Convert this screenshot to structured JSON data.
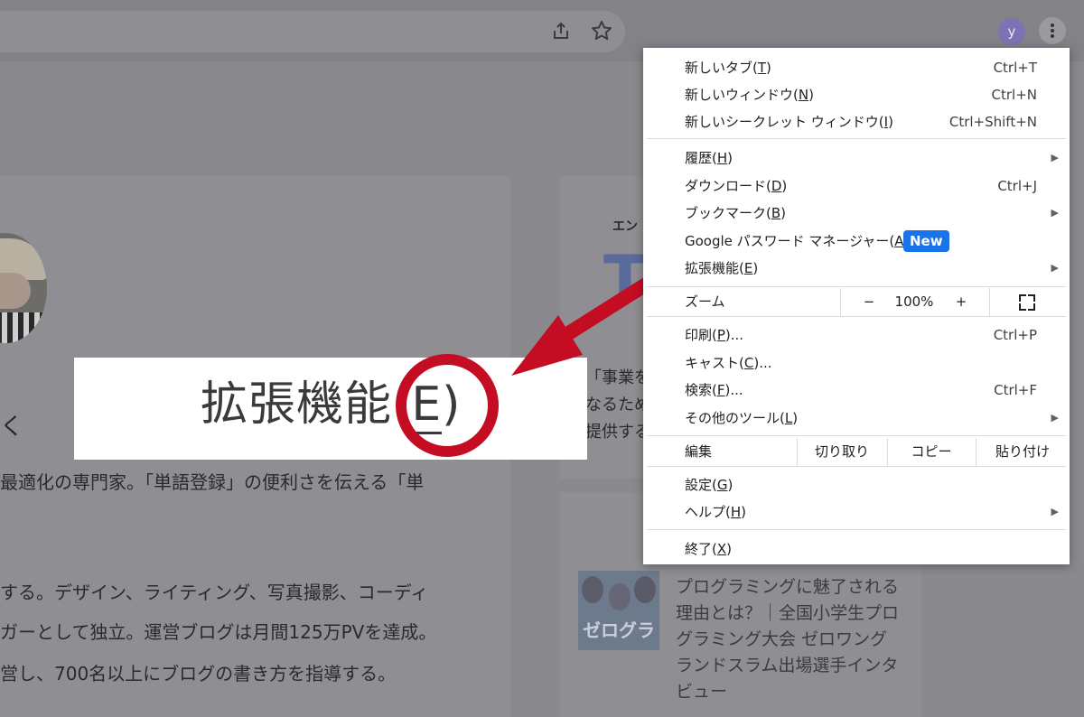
{
  "browser": {
    "avatar_letter": "y",
    "share_icon": "share-icon",
    "star_icon": "star-icon"
  },
  "background_page": {
    "left_card": {
      "line1": "最適化の専門家。「単語登録」の便利さを伝える「単",
      "line2": "する。デザイン、ライティング、写真撮影、コーディ",
      "line3": "ガーとして独立。運営ブログは月間125万PVを達成。",
      "line4": "営し、700名以上にブログの書き方を指導する。",
      "fragment": "く"
    },
    "right_card": {
      "small_label": "エン",
      "line1": "「事業を",
      "line2": "なるため",
      "line3": "提供する",
      "big_letter": "T"
    },
    "article": {
      "thumb_label": "ゼログラ",
      "title": "プログラミングに魅了される理由とは？｜全国小学生プログラミング大会 ゼロワングランドスラム出場選手インタビュー"
    }
  },
  "callout": {
    "text": "拡張機能",
    "paren_open": "(",
    "key": "E",
    "paren_close": ")"
  },
  "menu": {
    "new_tab": {
      "label": "新しいタブ(",
      "key": "T",
      "close": ")",
      "shortcut": "Ctrl+T"
    },
    "new_window": {
      "label": "新しいウィンドウ(",
      "key": "N",
      "close": ")",
      "shortcut": "Ctrl+N"
    },
    "incognito": {
      "label": "新しいシークレット ウィンドウ(",
      "key": "I",
      "close": ")",
      "shortcut": "Ctrl+Shift+N"
    },
    "history": {
      "label": "履歴(",
      "key": "H",
      "close": ")"
    },
    "downloads": {
      "label": "ダウンロード(",
      "key": "D",
      "close": ")",
      "shortcut": "Ctrl+J"
    },
    "bookmarks": {
      "label": "ブックマーク(",
      "key": "B",
      "close": ")"
    },
    "password_manager": {
      "label": "Google パスワード マネージャー(",
      "key": "A",
      "close": ")",
      "badge": "New"
    },
    "extensions": {
      "label": "拡張機能(",
      "key": "E",
      "close": ")"
    },
    "zoom": {
      "label": "ズーム",
      "minus": "−",
      "value": "100%",
      "plus": "+"
    },
    "print": {
      "label": "印刷(",
      "key": "P",
      "close": ")...",
      "shortcut": "Ctrl+P"
    },
    "cast": {
      "label": "キャスト(",
      "key": "C",
      "close": ")..."
    },
    "find": {
      "label": "検索(",
      "key": "F",
      "close": ")...",
      "shortcut": "Ctrl+F"
    },
    "more_tools": {
      "label": "その他のツール(",
      "key": "L",
      "close": ")"
    },
    "edit": {
      "label": "編集",
      "cut": "切り取り",
      "copy": "コピー",
      "paste": "貼り付け"
    },
    "settings": {
      "label": "設定(",
      "key": "G",
      "close": ")"
    },
    "help": {
      "label": "ヘルプ(",
      "key": "H",
      "close": ")"
    },
    "exit": {
      "label": "終了(",
      "key": "X",
      "close": ")"
    },
    "submenu_arrow": "▶"
  },
  "colors": {
    "accent_red": "#c40d23",
    "badge_blue": "#1a73e8",
    "avatar_purple": "#7d73b4"
  }
}
